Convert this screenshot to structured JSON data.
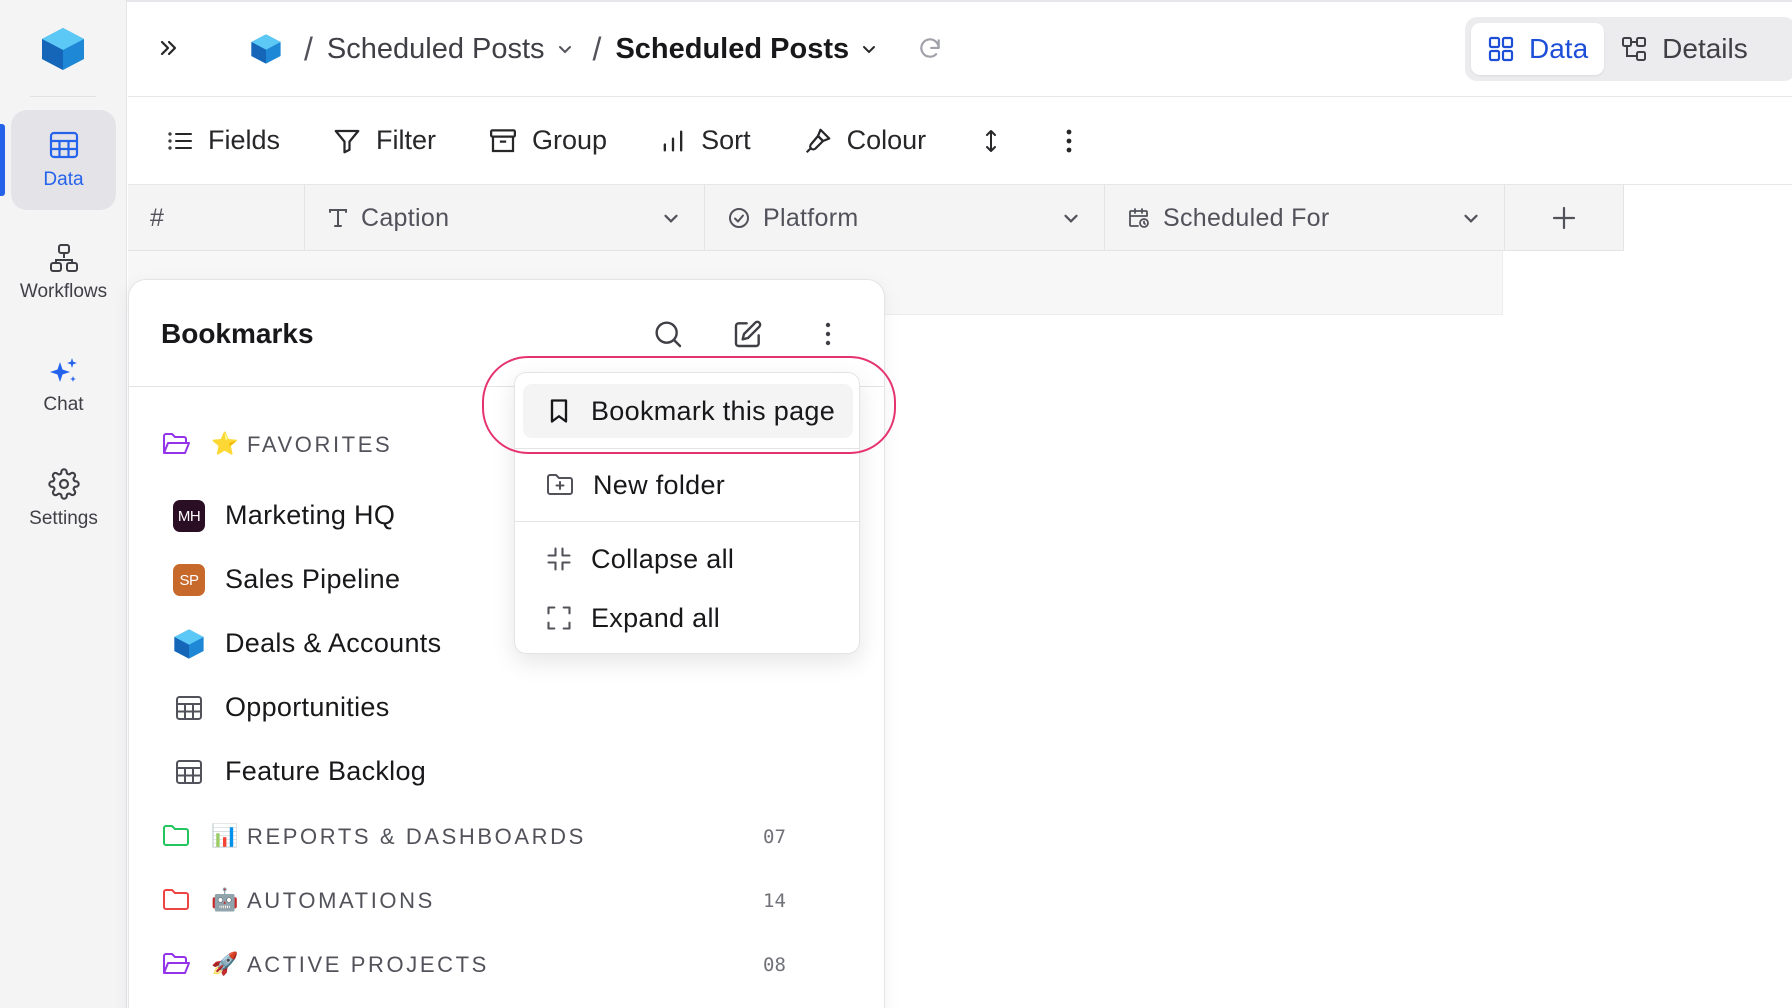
{
  "app": {
    "colors": {
      "accent": "#2563eb",
      "rail_bg": "#f4f4f5",
      "highlight": "#e6336e"
    }
  },
  "rail": {
    "items": [
      {
        "label": "Data",
        "icon": "table-icon",
        "active": true
      },
      {
        "label": "Workflows",
        "icon": "workflow-icon"
      },
      {
        "label": "Chat",
        "icon": "sparkles-icon"
      },
      {
        "label": "Settings",
        "icon": "gear-icon"
      }
    ]
  },
  "header": {
    "breadcrumbs": [
      {
        "label": "Scheduled Posts"
      },
      {
        "label": "Scheduled Posts"
      }
    ],
    "views": [
      {
        "label": "Data",
        "icon": "grid-icon",
        "active": true
      },
      {
        "label": "Details",
        "icon": "structure-icon"
      }
    ]
  },
  "toolbar": {
    "fields": "Fields",
    "filter": "Filter",
    "group": "Group",
    "sort": "Sort",
    "colour": "Colour"
  },
  "grid": {
    "columns": [
      {
        "label": "#"
      },
      {
        "label": "Caption",
        "icon": "text-type-icon"
      },
      {
        "label": "Platform",
        "icon": "check-circle-icon"
      },
      {
        "label": "Scheduled For",
        "icon": "calendar-clock-icon"
      }
    ]
  },
  "bookmarks": {
    "title": "Bookmarks",
    "sections": {
      "favorites": {
        "label": "FAVORITES",
        "emoji": "⭐"
      },
      "reports": {
        "label": "REPORTS & DASHBOARDS",
        "emoji": "📊",
        "count": "07"
      },
      "automations": {
        "label": "AUTOMATIONS",
        "emoji": "🤖",
        "count": "14"
      },
      "projects": {
        "label": "ACTIVE PROJECTS",
        "emoji": "🚀",
        "count": "08"
      }
    },
    "items": [
      {
        "label": "Marketing HQ",
        "badge": "MH",
        "badge_color": "#2a0f24"
      },
      {
        "label": "Sales Pipeline",
        "badge": "SP",
        "badge_color": "#c8692c"
      },
      {
        "label": "Deals & Accounts"
      },
      {
        "label": "Opportunities"
      },
      {
        "label": "Feature Backlog"
      }
    ]
  },
  "menu": {
    "bookmark_page": "Bookmark this page",
    "new_folder": "New folder",
    "collapse_all": "Collapse all",
    "expand_all": "Expand all"
  }
}
